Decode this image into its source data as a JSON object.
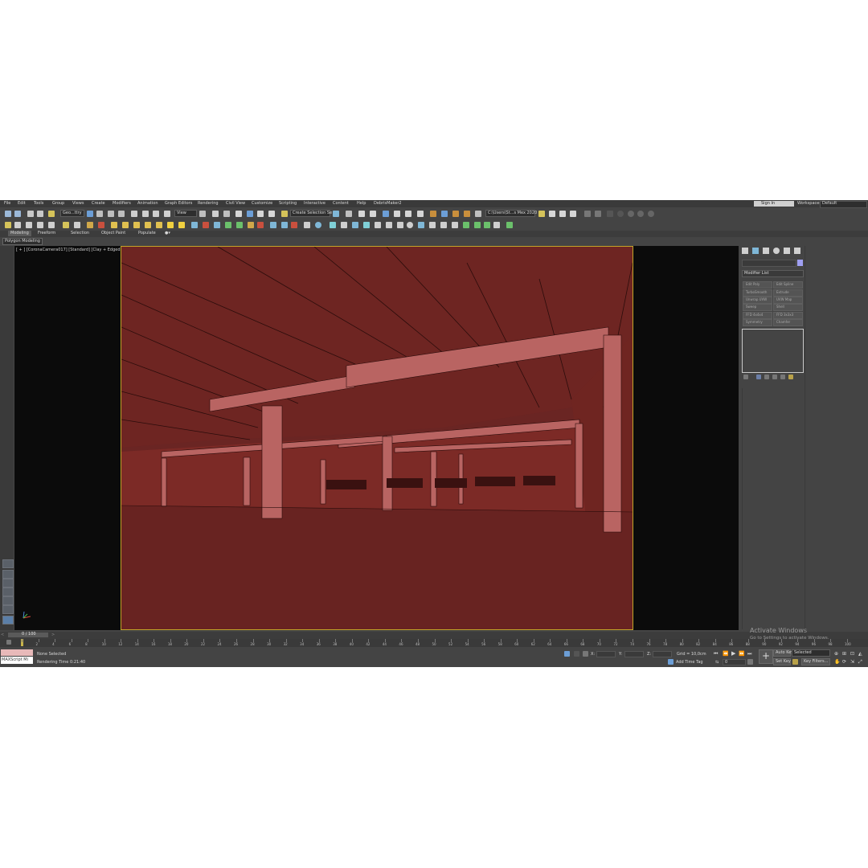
{
  "menu": {
    "items": [
      "File",
      "Edit",
      "Tools",
      "Group",
      "Views",
      "Create",
      "Modifiers",
      "Animation",
      "Graph Editors",
      "Rendering",
      "Civil View",
      "Customize",
      "Scripting",
      "Interactive",
      "Content",
      "Help",
      "DebrisMaker2"
    ],
    "sign_in": "Sign In",
    "workspaces_label": "Workspaces:",
    "workspace_value": "Default"
  },
  "toolbar": {
    "selection_filter": "Geo...ttry",
    "reference_coord": "View",
    "named_selection": "Create Selection Se",
    "project_path": "C:\\Users\\St...s Mex 2020"
  },
  "ribbon": {
    "tabs": [
      "Modeling",
      "Freeform",
      "Selection",
      "Object Paint",
      "Populate"
    ],
    "sub_label": "Polygon Modeling"
  },
  "viewport": {
    "label": "[ + ] [CoronaCamera017] [Standard] [Clay + Edged Faces]"
  },
  "command_panel": {
    "modifier_list": "Modifier List",
    "modifier_buttons": [
      "Edit Poly",
      "Edit Spline",
      "TurboSmooth",
      "Extrude",
      "Unwrap UVW",
      "UVW Map",
      "Sweep",
      "Shell",
      "FFD 4x4x4",
      "FFD 3x3x3",
      "Symmetry",
      "Chamfer"
    ]
  },
  "timeline": {
    "frame_display": "0 / 100",
    "ticks": [
      0,
      2,
      4,
      6,
      8,
      10,
      12,
      14,
      16,
      18,
      20,
      22,
      24,
      26,
      28,
      30,
      32,
      34,
      36,
      38,
      40,
      42,
      44,
      46,
      48,
      50,
      52,
      54,
      56,
      58,
      60,
      62,
      64,
      66,
      68,
      70,
      72,
      74,
      76,
      78,
      80,
      82,
      84,
      86,
      88,
      90,
      92,
      94,
      96,
      98,
      100
    ]
  },
  "status": {
    "maxscript_label": "MAXScript Mi",
    "selection": "None Selected",
    "render_time": "Rendering Time  0:21:40",
    "x_label": "X:",
    "y_label": "Y:",
    "z_label": "Z:",
    "grid": "Grid = 10,0cm",
    "add_time_tag": "Add Time Tag",
    "auto_key": "Auto Key",
    "set_key": "Set Key",
    "key_mode": "Selected",
    "key_filters": "Key Filters...",
    "frame": "0"
  },
  "watermark": {
    "line1": "Activate Windows",
    "line2": "Go to Settings to activate Windows."
  },
  "colors": {
    "scene_floor": "#6a2523",
    "scene_wall": "#7a2622",
    "scene_beam": "#b96462",
    "viewport_border": "#c2a428",
    "object_color": "#9f9ff2"
  }
}
